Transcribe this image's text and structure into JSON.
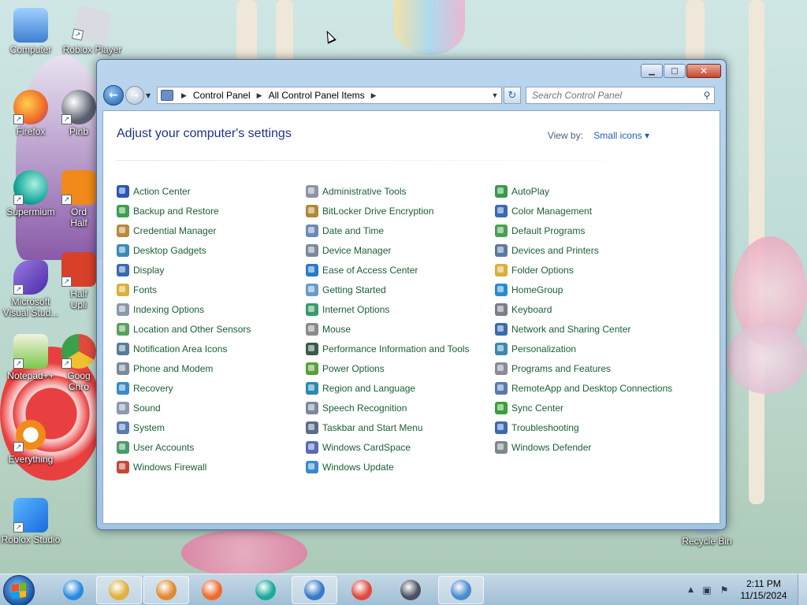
{
  "desktop": {
    "icons": [
      {
        "label": "Computer",
        "color": "#3f7fd0"
      },
      {
        "label": "Roblox Player",
        "color": "#d8dce2"
      },
      {
        "label": "Firefox",
        "color": "#f06a2a"
      },
      {
        "label": "Pinb",
        "color": "#5a6070"
      },
      {
        "label": "Supermium",
        "color": "#1aa99c"
      },
      {
        "label": "Ord Half",
        "color": "#f08a1a"
      },
      {
        "label": "Microsoft Visual Stud...",
        "color": "#6a4bc8"
      },
      {
        "label": "Half Upli",
        "color": "#d8402a"
      },
      {
        "label": "Notepad++",
        "color": "#7cc84a"
      },
      {
        "label": "Goog Chro",
        "color": "#4a8af0"
      },
      {
        "label": "Everything",
        "color": "#f08a1a"
      },
      {
        "label": "Roblox Studio",
        "color": "#2a8af0"
      },
      {
        "label": "Recycle Bin",
        "color": "#c0d0dc"
      }
    ]
  },
  "window": {
    "controls": {
      "minimize": "▁",
      "maximize": "□",
      "close": "✕"
    },
    "nav": {
      "back": "←",
      "forward": "→",
      "history": "▼"
    },
    "breadcrumb": [
      "Control Panel",
      "All Control Panel Items"
    ],
    "breadcrumb_sep": "▶",
    "address_dropdown": "▼",
    "refresh": "↻",
    "search_placeholder": "Search Control Panel",
    "search_icon": "⚲",
    "title": "Adjust your computer's settings",
    "view_by_label": "View by:",
    "view_by_value": "Small icons ▾"
  },
  "items": [
    {
      "label": "Action Center",
      "color": "#2a57b8"
    },
    {
      "label": "Administrative Tools",
      "color": "#8a96a8"
    },
    {
      "label": "AutoPlay",
      "color": "#3a9a4a"
    },
    {
      "label": "Backup and Restore",
      "color": "#3aa050"
    },
    {
      "label": "BitLocker Drive Encryption",
      "color": "#b0883a"
    },
    {
      "label": "Color Management",
      "color": "#3a6ab0"
    },
    {
      "label": "Credential Manager",
      "color": "#b88a3a"
    },
    {
      "label": "Date and Time",
      "color": "#6a8ab8"
    },
    {
      "label": "Default Programs",
      "color": "#4aa050"
    },
    {
      "label": "Desktop Gadgets",
      "color": "#3a8ab8"
    },
    {
      "label": "Device Manager",
      "color": "#7a8a9a"
    },
    {
      "label": "Devices and Printers",
      "color": "#5a7aa0"
    },
    {
      "label": "Display",
      "color": "#3a6ab0"
    },
    {
      "label": "Ease of Access Center",
      "color": "#2a7ac8"
    },
    {
      "label": "Folder Options",
      "color": "#d8b03a"
    },
    {
      "label": "Fonts",
      "color": "#d8b03a"
    },
    {
      "label": "Getting Started",
      "color": "#6a9ac8"
    },
    {
      "label": "HomeGroup",
      "color": "#2a8ad0"
    },
    {
      "label": "Indexing Options",
      "color": "#8a9aaa"
    },
    {
      "label": "Internet Options",
      "color": "#3a9a6a"
    },
    {
      "label": "Keyboard",
      "color": "#7a8088"
    },
    {
      "label": "Location and Other Sensors",
      "color": "#5aa05a"
    },
    {
      "label": "Mouse",
      "color": "#8a8a8a"
    },
    {
      "label": "Network and Sharing Center",
      "color": "#3a6ab0"
    },
    {
      "label": "Notification Area Icons",
      "color": "#5a7a9a"
    },
    {
      "label": "Performance Information and Tools",
      "color": "#3a5a4a"
    },
    {
      "label": "Personalization",
      "color": "#3a8ab0"
    },
    {
      "label": "Phone and Modem",
      "color": "#7a8a9a"
    },
    {
      "label": "Power Options",
      "color": "#5aa03a"
    },
    {
      "label": "Programs and Features",
      "color": "#8a8a9a"
    },
    {
      "label": "Recovery",
      "color": "#3a8ac8"
    },
    {
      "label": "Region and Language",
      "color": "#2a8ab0"
    },
    {
      "label": "RemoteApp and Desktop Connections",
      "color": "#5a7ab0"
    },
    {
      "label": "Sound",
      "color": "#8a9aaa"
    },
    {
      "label": "Speech Recognition",
      "color": "#7a8a9a"
    },
    {
      "label": "Sync Center",
      "color": "#3aa03a"
    },
    {
      "label": "System",
      "color": "#5a7ab0"
    },
    {
      "label": "Taskbar and Start Menu",
      "color": "#5a6a8a"
    },
    {
      "label": "Troubleshooting",
      "color": "#3a6ab0"
    },
    {
      "label": "User Accounts",
      "color": "#4a9a6a"
    },
    {
      "label": "Windows CardSpace",
      "color": "#5a6ab8"
    },
    {
      "label": "Windows Defender",
      "color": "#7a8a8a"
    },
    {
      "label": "Windows Firewall",
      "color": "#c04a3a"
    },
    {
      "label": "Windows Update",
      "color": "#3a8ac8"
    }
  ],
  "taskbar": {
    "apps": [
      {
        "name": "internet-explorer",
        "color": "#2a8ae0",
        "pinned": false
      },
      {
        "name": "windows-explorer",
        "color": "#e0b040",
        "pinned": true
      },
      {
        "name": "media-player",
        "color": "#e08a30",
        "pinned": true
      },
      {
        "name": "firefox",
        "color": "#f06a2a",
        "pinned": false
      },
      {
        "name": "supermium",
        "color": "#1aa99c",
        "pinned": false
      },
      {
        "name": "network-app",
        "color": "#3a7ac8",
        "pinned": true
      },
      {
        "name": "chrome",
        "color": "#e04a3a",
        "pinned": false
      },
      {
        "name": "pinball",
        "color": "#4a5060",
        "pinned": false
      },
      {
        "name": "control-panel",
        "color": "#4a8ad0",
        "pinned": true
      }
    ],
    "tray_expand": "▲",
    "time": "2:11 PM",
    "date": "11/15/2024"
  }
}
